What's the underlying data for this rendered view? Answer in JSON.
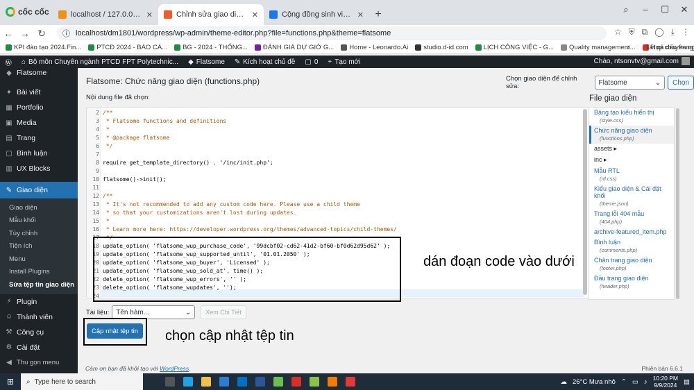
{
  "browser": {
    "logo_text": "cốc cốc",
    "tabs": [
      {
        "label": "localhost / 127.0.0.1 / dm1801 | p",
        "color": "#f29111",
        "active": false
      },
      {
        "label": "Chỉnh sửa giao diện ‹ Bộ môn",
        "color": "#f25c2a",
        "active": true
      },
      {
        "label": "Cộng đồng sinh viên chuyên ngàn",
        "color": "#1877f2",
        "active": false
      }
    ],
    "new_tab": "+",
    "url": "localhost/dm1801/wordpress/wp-admin/theme-editor.php?file=functions.php&theme=flatsome",
    "bookmarks": [
      {
        "label": "KPI đào tạo 2024.Fin...",
        "color": "#1e8e3e"
      },
      {
        "label": "PTCĐ 2024 - BÁO CÁ...",
        "color": "#1e8e3e"
      },
      {
        "label": "BG - 2024 - THỐNG...",
        "color": "#1e8e3e"
      },
      {
        "label": "ĐÁNH GIÁ DỰ GIỜ G...",
        "color": "#7b1fa2"
      },
      {
        "label": "Home - Leonardo.Ai",
        "color": "#555555"
      },
      {
        "label": "studio.d-id.com",
        "color": "#333333"
      },
      {
        "label": "LỊCH CÔNG VIỆC - G...",
        "color": "#1e8e3e"
      },
      {
        "label": "Quality management...",
        "color": "#888888"
      },
      {
        "label": "Họp chuyên ngành ri...",
        "color": "#d93025"
      }
    ],
    "bookmarks_more": "»",
    "bookmarks_all": "Tất cả dấu trang"
  },
  "adminbar": {
    "site": "Bộ môn Chuyên ngành PTCD FPT Polytechnic...",
    "theme": "Flatsome",
    "activate": "Kích hoạt chủ đề",
    "comments": "0",
    "new": "Tạo mới",
    "greeting": "Chào, ntsonvtv@gmail.com"
  },
  "sidebar": {
    "top": "Flatsome",
    "items": [
      {
        "label": "Bài viết",
        "icon": "pin-icon"
      },
      {
        "label": "Portfolio",
        "icon": "portfolio-icon"
      },
      {
        "label": "Media",
        "icon": "media-icon"
      },
      {
        "label": "Trang",
        "icon": "page-icon"
      },
      {
        "label": "Bình luận",
        "icon": "comment-icon"
      },
      {
        "label": "UX Blocks",
        "icon": "blocks-icon"
      }
    ],
    "current": "Giao diện",
    "sub": [
      "Giao diện",
      "Mẫu khối",
      "Tùy chỉnh",
      "Tiện ích",
      "Menu",
      "Install Plugins",
      "Sửa tệp tin giao diện"
    ],
    "after": [
      {
        "label": "Plugin",
        "icon": "plugin-icon"
      },
      {
        "label": "Thành viên",
        "icon": "users-icon"
      },
      {
        "label": "Công cụ",
        "icon": "tools-icon"
      },
      {
        "label": "Cài đặt",
        "icon": "settings-icon"
      }
    ],
    "collapse": "Thu gọn menu"
  },
  "main": {
    "title": "Flatsome: Chức năng giao diện (functions.php)",
    "select_theme_label": "Chọn giao diện để chỉnh sửa:",
    "select_theme_value": "Flatsome",
    "select_button": "Chọn",
    "file_label": "Nội dung file đã chọn:",
    "docs_label": "Tài liệu:",
    "docs_select": "Tên hàm...",
    "docs_button": "Xem Chi Tiết",
    "update_button": "Cập nhật tệp tin",
    "footer_thanks": "Cảm ơn bạn đã khởi tạo với",
    "footer_link": "WordPress",
    "version": "Phiên bản 6.6.1"
  },
  "code_lines": [
    {
      "n": "2",
      "t": "/**",
      "c": "com"
    },
    {
      "n": "3",
      "t": " * Flatsome functions and definitions",
      "c": "com"
    },
    {
      "n": "4",
      "t": " *",
      "c": "com"
    },
    {
      "n": "5",
      "t": " * @package flatsome",
      "c": "com"
    },
    {
      "n": "6",
      "t": " */",
      "c": "com"
    },
    {
      "n": "7",
      "t": "",
      "c": "plain"
    },
    {
      "n": "8",
      "t": "require get_template_directory() . '/inc/init.php';",
      "c": "plain"
    },
    {
      "n": "9",
      "t": "",
      "c": "plain"
    },
    {
      "n": "10",
      "t": "flatsome()->init();",
      "c": "plain"
    },
    {
      "n": "11",
      "t": "",
      "c": "plain"
    },
    {
      "n": "12",
      "t": "/**",
      "c": "com"
    },
    {
      "n": "13",
      "t": " * It's not recommended to add any custom code here. Please use a child theme",
      "c": "com"
    },
    {
      "n": "14",
      "t": " * so that your customizations aren't lost during updates.",
      "c": "com"
    },
    {
      "n": "15",
      "t": " *",
      "c": "com"
    },
    {
      "n": "16",
      "t": " * Learn more here: https://developer.wordpress.org/themes/advanced-topics/child-themes/",
      "c": "com"
    },
    {
      "n": "17",
      "t": " */",
      "c": "com"
    },
    {
      "n": "18",
      "t": "update_option( 'flatsome_wup_purchase_code', '99dcbf02-cd62-41d2-bf60-bf0d62d95d62' );",
      "c": "plain"
    },
    {
      "n": "19",
      "t": "update_option( 'flatsome_wup_supported_until', '01.01.2050' );",
      "c": "plain"
    },
    {
      "n": "20",
      "t": "update_option( 'flatsome_wup_buyer', 'Licensed' );",
      "c": "plain"
    },
    {
      "n": "21",
      "t": "update_option( 'flatsome_wup_sold_at', time() );",
      "c": "plain"
    },
    {
      "n": "22",
      "t": "delete_option( 'flatsome_wup_errors', '' );",
      "c": "plain"
    },
    {
      "n": "23",
      "t": "delete_option( 'flatsome_wupdates', '');",
      "c": "plain"
    },
    {
      "n": "24",
      "t": "",
      "c": "plain"
    }
  ],
  "files": {
    "heading": "File giao diện",
    "list": [
      {
        "label": "Bảng tạo kiểu hiển thị",
        "sub": "(style.css)",
        "cur": false,
        "folder": false
      },
      {
        "label": "Chức năng giao diện",
        "sub": "(functions.php)",
        "cur": true,
        "folder": false
      },
      {
        "label": "assets ▸",
        "sub": "",
        "cur": false,
        "folder": true
      },
      {
        "label": "inc ▸",
        "sub": "",
        "cur": false,
        "folder": true
      },
      {
        "label": "Mẫu RTL",
        "sub": "(rtl.css)",
        "cur": false,
        "folder": false
      },
      {
        "label": "Kiểu giao diện & Cài đặt khối",
        "sub": "(theme.json)",
        "cur": false,
        "folder": false
      },
      {
        "label": "Trang lỗi 404 mẫu",
        "sub": "(404.php)",
        "cur": false,
        "folder": false
      },
      {
        "label": "archive-featured_item.php",
        "sub": "",
        "cur": false,
        "folder": false
      },
      {
        "label": "Bình luận",
        "sub": "(comments.php)",
        "cur": false,
        "folder": false
      },
      {
        "label": "Chân trang giao diện",
        "sub": "(footer.php)",
        "cur": false,
        "folder": false
      },
      {
        "label": "Đầu trang giao diện",
        "sub": "(header.php)",
        "cur": false,
        "folder": false
      }
    ]
  },
  "annotations": {
    "paste": "dán đoạn code vào dưới",
    "update": "chọn cập nhật tệp tin"
  },
  "taskbar": {
    "search": "Type here to search",
    "weather": "26°C  Mưa nhỏ",
    "time": "10:20 PM",
    "date": "9/9/2024"
  }
}
